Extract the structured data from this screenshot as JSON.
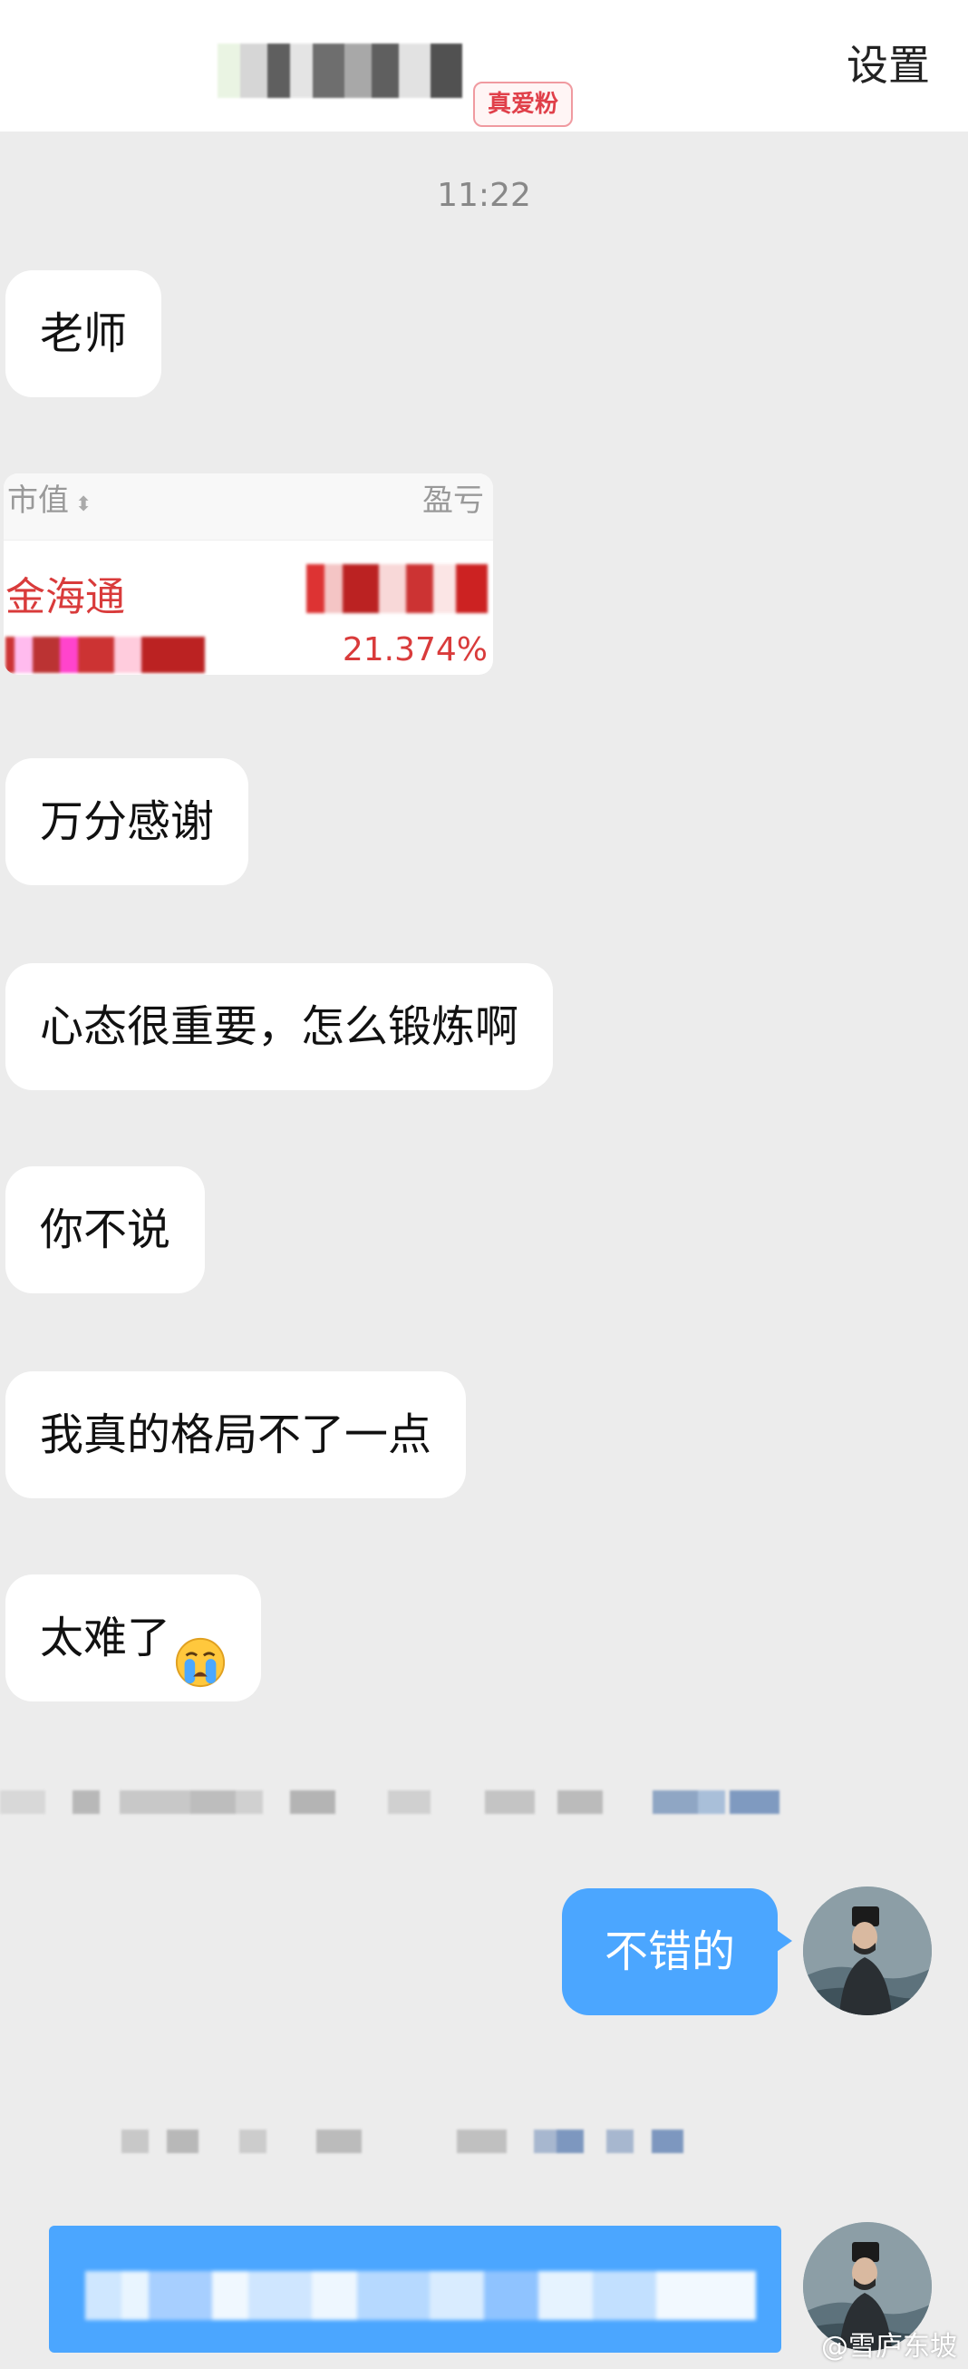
{
  "header": {
    "badge": "真爱粉",
    "settings_label": "设置"
  },
  "timestamp": "11:22",
  "messages_left": [
    "老师",
    "万分感谢",
    "心态很重要，怎么锻炼啊",
    "你不说",
    "我真的格局不了一点",
    "太难了"
  ],
  "shared_image": {
    "col_left": "市值",
    "col_right": "盈亏",
    "stock_name": "金海通",
    "percent": "21.374%"
  },
  "messages_right": [
    "不错的"
  ],
  "icons": {
    "emoji": "crying-face-icon",
    "sort": "sort-arrows-icon"
  },
  "colors": {
    "bubble_right": "#4ba6ff",
    "bubble_left": "#ffffff",
    "background": "#ececec",
    "badge": "#e0404a",
    "stock_red": "#d93b3b"
  },
  "watermark": "@雪庐东坡"
}
